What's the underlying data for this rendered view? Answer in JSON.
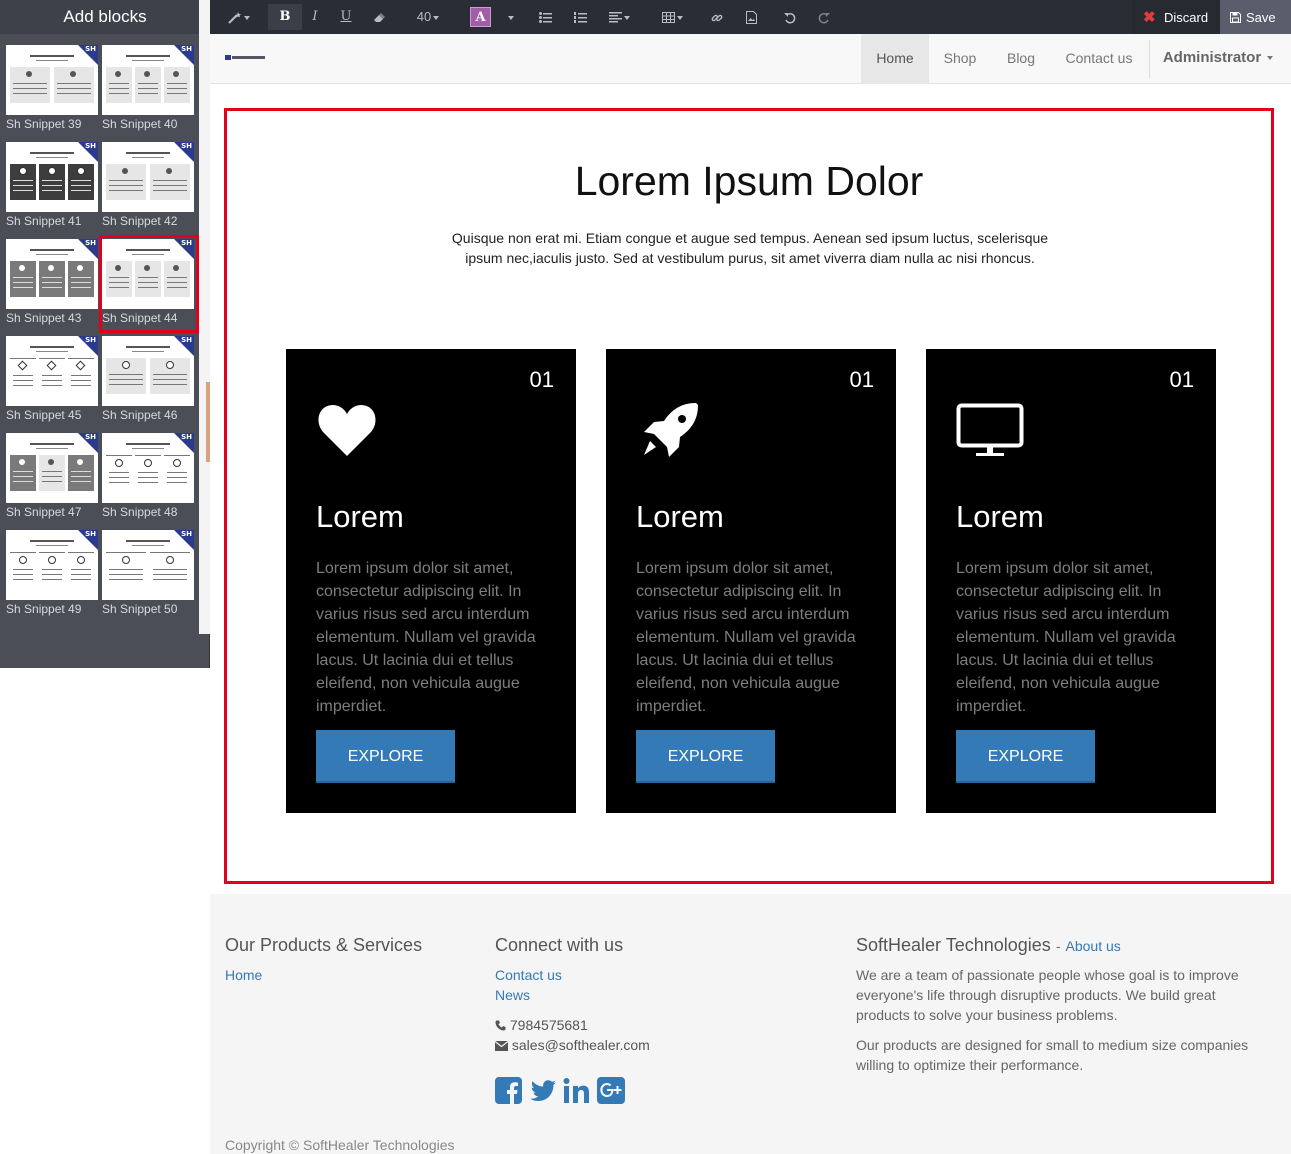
{
  "editor": {
    "panel_title": "Add blocks",
    "toolbar": {
      "bold": "B",
      "italic": "I",
      "underline": "U",
      "font_size": "40",
      "color_label": "A",
      "discard": "Discard",
      "save": "Save"
    },
    "snippets": [
      {
        "label": "Sh Snippet 39"
      },
      {
        "label": "Sh Snippet 40"
      },
      {
        "label": "Sh Snippet 41"
      },
      {
        "label": "Sh Snippet 42"
      },
      {
        "label": "Sh Snippet 43"
      },
      {
        "label": "Sh Snippet 44",
        "selected": true
      },
      {
        "label": "Sh Snippet 45"
      },
      {
        "label": "Sh Snippet 46"
      },
      {
        "label": "Sh Snippet 47"
      },
      {
        "label": "Sh Snippet 48"
      },
      {
        "label": "Sh Snippet 49"
      },
      {
        "label": "Sh Snippet 50"
      }
    ],
    "badge": "SH"
  },
  "nav": {
    "items": [
      "Home",
      "Shop",
      "Blog",
      "Contact us"
    ],
    "active": "Home",
    "user": "Administrator"
  },
  "hero": {
    "title": "Lorem Ipsum Dolor",
    "text": "Quisque non erat mi. Etiam congue et augue sed tempus. Aenean sed ipsum luctus, scelerisque ipsum nec,iaculis justo. Sed at vestibulum purus, sit amet viverra diam nulla ac nisi rhoncus."
  },
  "cards": [
    {
      "num": "01",
      "icon": "heart-icon",
      "title": "Lorem",
      "text": "Lorem ipsum dolor sit amet, consectetur adipiscing elit. In varius risus sed arcu interdum elementum. Nullam vel gravida lacus. Ut lacinia dui et tellus eleifend, non vehicula augue imperdiet.",
      "button": "EXPLORE"
    },
    {
      "num": "01",
      "icon": "rocket-icon",
      "title": "Lorem",
      "text": "Lorem ipsum dolor sit amet, consectetur adipiscing elit. In varius risus sed arcu interdum elementum. Nullam vel gravida lacus. Ut lacinia dui et tellus eleifend, non vehicula augue imperdiet.",
      "button": "EXPLORE"
    },
    {
      "num": "01",
      "icon": "monitor-icon",
      "title": "Lorem",
      "text": "Lorem ipsum dolor sit amet, consectetur adipiscing elit. In varius risus sed arcu interdum elementum. Nullam vel gravida lacus. Ut lacinia dui et tellus eleifend, non vehicula augue imperdiet.",
      "button": "EXPLORE"
    }
  ],
  "footer": {
    "products_title": "Our Products & Services",
    "products_links": [
      "Home"
    ],
    "connect_title": "Connect with us",
    "connect_links": [
      "Contact us",
      "News"
    ],
    "phone": "7984575681",
    "email": "sales@softhealer.com",
    "company_title": "SoftHealer Technologies",
    "about_sep": "-",
    "about_link": "About us",
    "about_p1": "We are a team of passionate people whose goal is to improve everyone's life through disruptive products. We build great products to solve your business problems.",
    "about_p2": "Our products are designed for small to medium size companies willing to optimize their performance.",
    "copyright": "Copyright © SoftHealer Technologies"
  },
  "colors": {
    "selection_red": "#e2001a",
    "button_blue": "#337ab7",
    "link_blue": "#337ab7",
    "card_bg": "#000000"
  }
}
